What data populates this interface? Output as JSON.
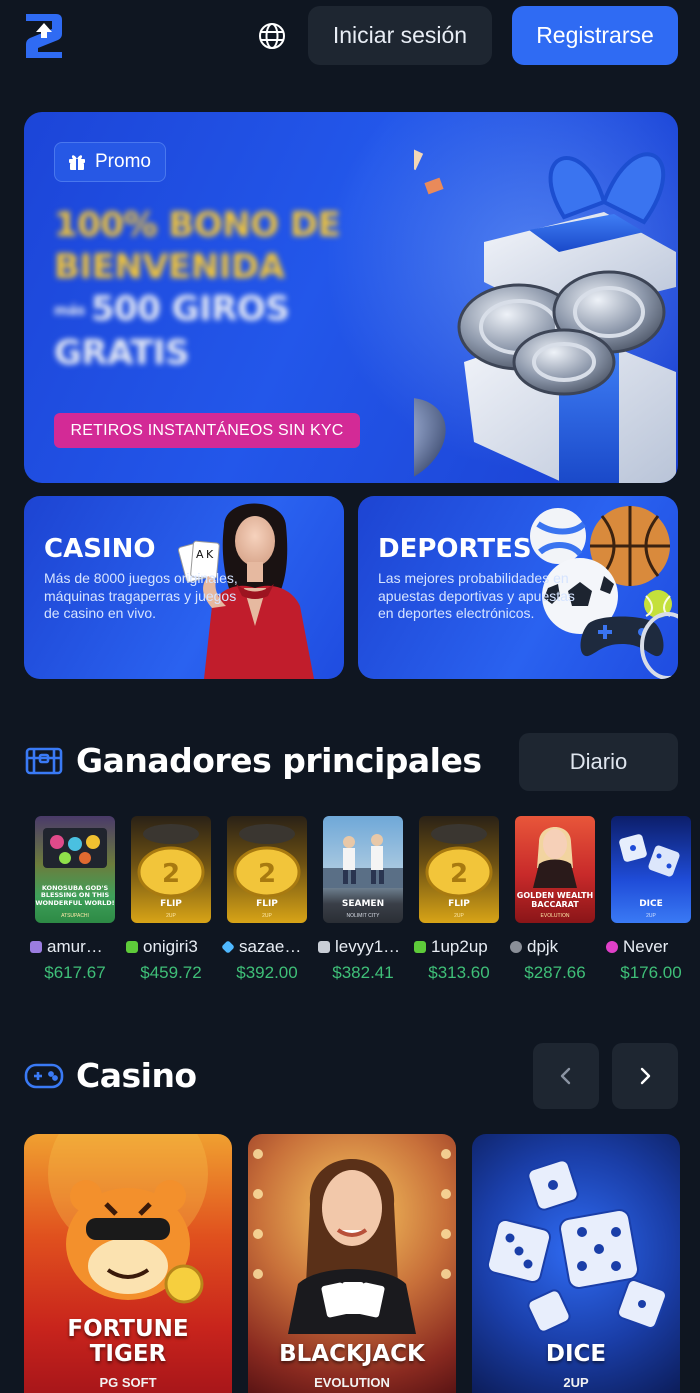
{
  "header": {
    "login_label": "Iniciar sesión",
    "register_label": "Registrarse"
  },
  "hero": {
    "promo_label": "Promo",
    "title_line1": "100% BONO DE",
    "title_line2": "BIENVENIDA",
    "title_small": "más",
    "title_line3": "500 GIROS",
    "title_line4": "GRATIS",
    "cta_label": "RETIROS INSTANTÁNEOS SIN KYC"
  },
  "categories": {
    "casino": {
      "title": "CASINO",
      "description": "Más de 8000 juegos originales, máquinas tragaperras y juegos de casino en vivo."
    },
    "sports": {
      "title": "DEPORTES",
      "description": "Las mejores probabilidades en apuestas deportivas y apuestas en deportes electrónicos."
    }
  },
  "winners_section": {
    "title": "Ganadores principales",
    "period_label": "Diario",
    "items": [
      {
        "user": "amur…",
        "amount": "$617.67",
        "game": "KONOSUBA GOD'S BLESSING ON THIS WONDERFUL WORLD!",
        "provider": "ATSUPACHI",
        "badge_color": "#9b7de0"
      },
      {
        "user": "onigiri3",
        "amount": "$459.72",
        "game": "FLIP",
        "provider": "2UP",
        "badge_color": "#5ecb3a"
      },
      {
        "user": "sazae…",
        "amount": "$392.00",
        "game": "FLIP",
        "provider": "2UP",
        "badge_color": "#4fb8ff"
      },
      {
        "user": "levyy1…",
        "amount": "$382.41",
        "game": "SEAMEN",
        "provider": "NOLIMIT CITY",
        "badge_color": "#c9ced6"
      },
      {
        "user": "1up2up",
        "amount": "$313.60",
        "game": "FLIP",
        "provider": "2UP",
        "badge_color": "#5ecb3a"
      },
      {
        "user": "dpjk",
        "amount": "$287.66",
        "game": "GOLDEN WEALTH BACCARAT",
        "provider": "EVOLUTION",
        "badge_color": "#8a8f98"
      },
      {
        "user": "Never",
        "amount": "$176.00",
        "game": "DICE",
        "provider": "2UP",
        "badge_color": "#e040c8"
      }
    ]
  },
  "casino_section": {
    "title": "Casino",
    "games": [
      {
        "title_line1": "FORTUNE",
        "title_line2": "TIGER",
        "provider": "PG SOFT"
      },
      {
        "title_line1": "",
        "title_line2": "BLACKJACK",
        "provider": "EVOLUTION"
      },
      {
        "title_line1": "",
        "title_line2": "DICE",
        "provider": "2UP"
      }
    ]
  },
  "colors": {
    "background": "#0f1621",
    "accent": "#2f6bf3",
    "surface": "#1e2631",
    "win_green": "#3fbf78",
    "promo_yellow": "#f2c53a",
    "kyc_pink": "#d32a96"
  },
  "icons": {
    "logo": "brand-logo-icon",
    "language": "globe-icon",
    "promo": "gift-icon",
    "winners": "treasure-chest-icon",
    "casino": "gamepad-icon",
    "prev": "chevron-left-icon",
    "next": "chevron-right-icon"
  }
}
